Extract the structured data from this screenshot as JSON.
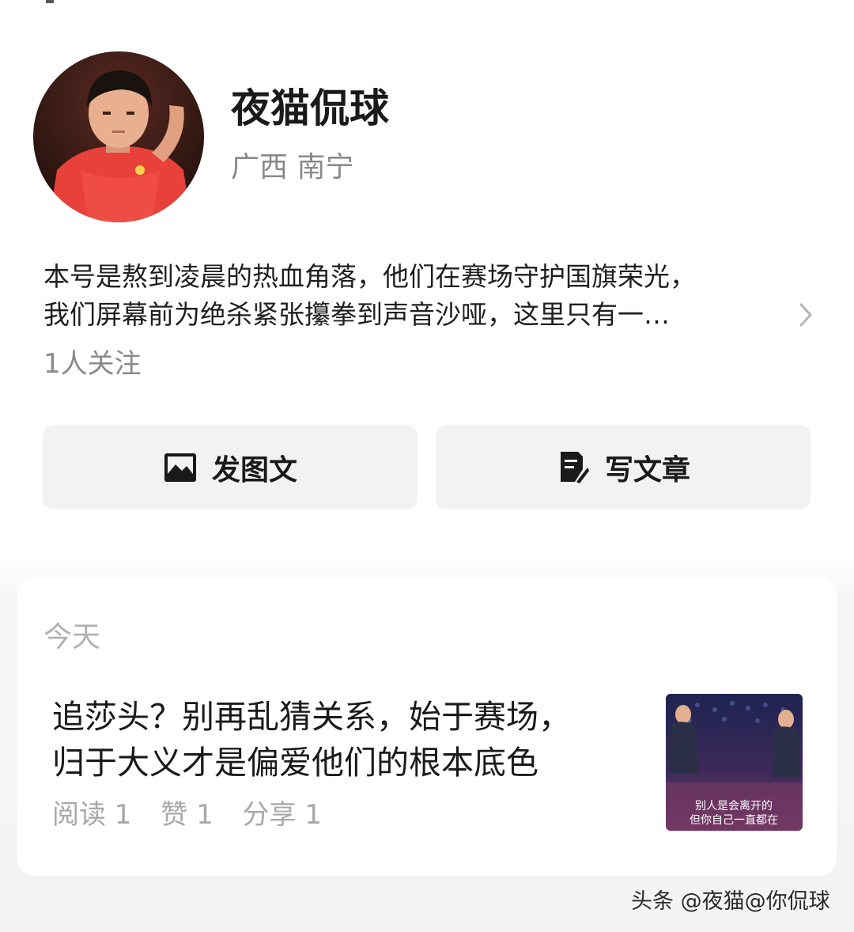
{
  "profile": {
    "name": "夜猫侃球",
    "location": "广西 南宁",
    "bio_line1": "本号是熬到凌晨的热血角落，他们在赛场守护国旗荣光，",
    "bio_line2": "我们屏幕前为绝杀紧张攥拳到声音沙哑，这里只有一…",
    "followers": "1人关注"
  },
  "actions": {
    "post_image_label": "发图文",
    "write_article_label": "写文章"
  },
  "feed": {
    "section_label": "今天",
    "article": {
      "title_line1": "追莎头？别再乱猜关系，始于赛场，",
      "title_line2": "归于大义才是偏爱他们的根本底色",
      "reads": "阅读 1",
      "likes": "赞 1",
      "shares": "分享 1",
      "thumbnail_caption_line1": "别人是会离开的",
      "thumbnail_caption_line2": "但你自己一直都在"
    }
  },
  "watermark": "头条 @夜猫@你侃球",
  "icons": {
    "post_image": "image-icon",
    "write_article": "note-edit-icon",
    "bio_expand": "chevron-right-icon"
  },
  "colors": {
    "button_bg": "#f2f2f2",
    "secondary_text": "#8a8a8a",
    "jersey_red": "#e8413a"
  }
}
